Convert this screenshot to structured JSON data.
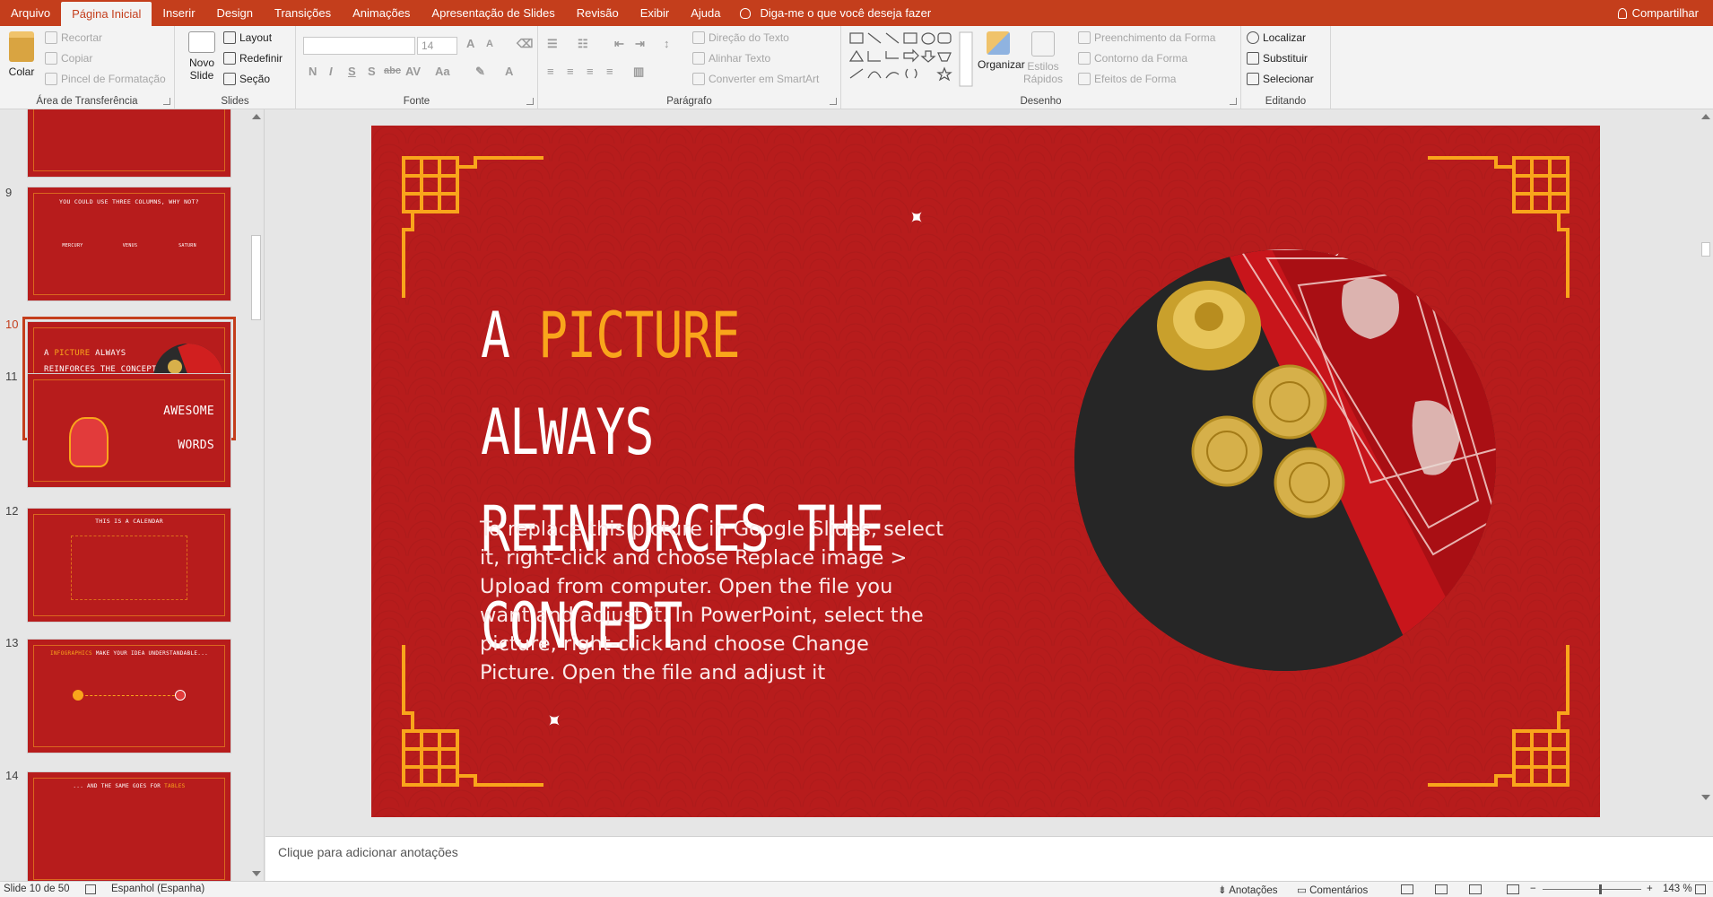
{
  "ribbon_tabs": [
    "Arquivo",
    "Página Inicial",
    "Inserir",
    "Design",
    "Transições",
    "Animações",
    "Apresentação de Slides",
    "Revisão",
    "Exibir",
    "Ajuda"
  ],
  "active_tab_index": 1,
  "tell_me": "Diga-me o que você deseja fazer",
  "share": "Compartilhar",
  "clipboard": {
    "paste": "Colar",
    "cut": "Recortar",
    "copy": "Copiar",
    "format_painter": "Pincel de Formatação",
    "label": "Área de Transferência"
  },
  "slides_group": {
    "new_slide": "Novo",
    "new_slide_2": "Slide",
    "layout": "Layout",
    "reset": "Redefinir",
    "section": "Seção",
    "label": "Slides"
  },
  "font_group": {
    "font_size": "14",
    "label": "Fonte",
    "bold": "N",
    "italic": "I",
    "underline": "S",
    "shadow": "S",
    "strike": "abc",
    "spacing": "AV",
    "case": "Aa",
    "color": "A"
  },
  "paragraph_group": {
    "text_direction": "Direção do Texto",
    "align_text": "Alinhar Texto",
    "smartart": "Converter em SmartArt",
    "label": "Parágrafo"
  },
  "drawing_group": {
    "arrange": "Organizar",
    "quick_styles": "Estilos",
    "quick_styles_2": "Rápidos",
    "fill": "Preenchimento da Forma",
    "outline": "Contorno da Forma",
    "effects": "Efeitos de Forma",
    "label": "Desenho"
  },
  "editing_group": {
    "find": "Localizar",
    "replace": "Substituir",
    "select": "Selecionar",
    "label": "Editando"
  },
  "thumbnails": [
    {
      "num": "9",
      "title": "YOU COULD USE THREE COLUMNS, WHY NOT?",
      "cols": [
        "MERCURY",
        "VENUS",
        "SATURN"
      ]
    },
    {
      "num": "10",
      "title_a": "A ",
      "title_hl": "PICTURE",
      "title_b": " ALWAYS",
      "title_c": "REINFORCES THE CONCEPT",
      "selected": true
    },
    {
      "num": "11",
      "title": "AWESOME",
      "title_2": "WORDS"
    },
    {
      "num": "12",
      "title": "THIS IS A CALENDAR"
    },
    {
      "num": "13",
      "title_hl": "INFOGRAPHICS",
      "title": " MAKE YOUR IDEA UNDERSTANDABLE..."
    },
    {
      "num": "14",
      "title": "... AND THE SAME GOES FOR ",
      "title_hl": "TABLES"
    }
  ],
  "slide": {
    "title_pre": "A ",
    "title_highlight": "PICTURE",
    "title_post": " ALWAYS",
    "title_line2": "REINFORCES THE CONCEPT",
    "body": "To replace this picture in Google Slides, select it, right-click and choose Replace image > Upload from computer. Open the file you want and adjust it. In PowerPoint, select the picture, right-click and choose Change Picture. Open the file and adjust it",
    "background_color": "#b71c1c",
    "accent_color": "#f9a51b"
  },
  "notes_placeholder": "Clique para adicionar anotações",
  "status": {
    "slide_of": "Slide 10 de 50",
    "language": "Espanhol (Espanha)",
    "notes": "Anotações",
    "comments": "Comentários",
    "zoom": "143 %",
    "minus": "−",
    "plus": "+"
  },
  "colors": {
    "ribbon_accent": "#c43e1c",
    "slide_red": "#b71c1c",
    "ornament_gold": "#f9a51b"
  }
}
